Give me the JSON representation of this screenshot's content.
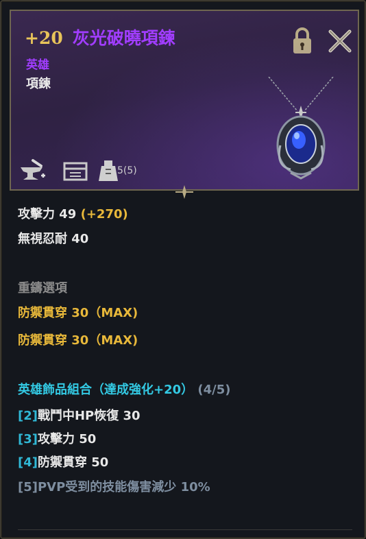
{
  "item": {
    "enhance": "+20",
    "name": "灰光破曉項鍊",
    "grade": "英雄",
    "type": "項鍊",
    "weight": "5(5)"
  },
  "stats": {
    "attack_label": "攻擊力 49",
    "attack_bonus": "(+270)",
    "ignore_resist": "無視忍耐 40"
  },
  "reforge": {
    "header": "重鑄選項",
    "options": [
      "防禦貫穿 30（MAX)",
      "防禦貫穿 30（MAX)"
    ]
  },
  "set_bonus": {
    "title": "英雄飾品組合（達成強化+20）",
    "progress": "(4/5)",
    "entries": [
      {
        "tier": "[2]",
        "text": "戰鬥中HP恢復 30"
      },
      {
        "tier": "[3]",
        "text": "攻擊力 50"
      },
      {
        "tier": "[4]",
        "text": "防禦貫穿 50"
      },
      {
        "tier": "[5]",
        "text": "PVP受到的技能傷害減少 10%"
      }
    ]
  },
  "icons": [
    "lock-icon",
    "close-icon",
    "pendant-image",
    "smith-anvil-icon",
    "storage-chest-icon",
    "weight-icon"
  ],
  "colors": {
    "enhance": "#e8c45a",
    "hero_grade": "#a13dff",
    "gold_text": "#e8b83a",
    "set_cyan": "#33c9e3",
    "inactive": "#7e8ea0"
  }
}
